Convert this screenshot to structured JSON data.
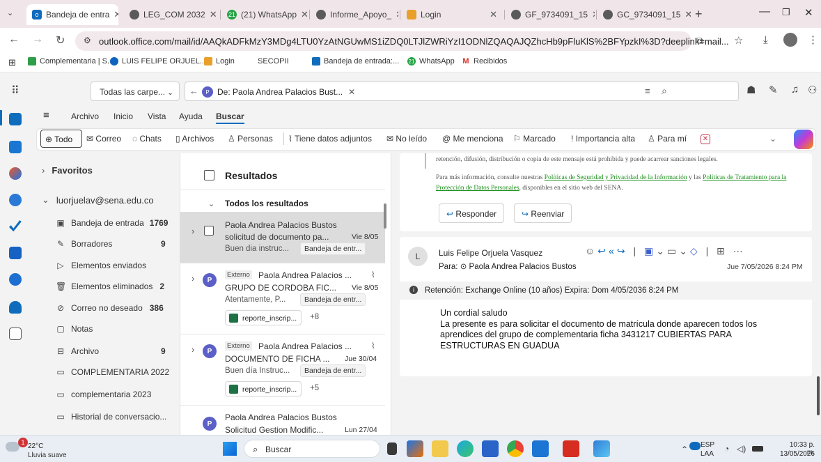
{
  "browser": {
    "tabs": [
      {
        "label": "Bandeja de entra",
        "active": true
      },
      {
        "label": "LEG_COM 2032",
        "active": false
      },
      {
        "label": "(21) WhatsApp",
        "active": false
      },
      {
        "label": "Informe_Apoyo_",
        "active": false
      },
      {
        "label": "Login",
        "active": false
      },
      {
        "label": "GF_9734091_15",
        "active": false
      },
      {
        "label": "GC_9734091_15",
        "active": false
      }
    ],
    "new_tab": "+",
    "url": "outlook.office.com/mail/id/AAQkADFkMzY3MDg4LTU0YzAtNGUwMS1iZDQ0LTJlZWRiYzI1ODNlZQAQAJQZhcHb9pFluKlS%2BFYpzkI%3D?deeplink=mail...",
    "bookmarks": [
      "Complementaria | S...",
      "LUIS FELIPE ORJUEL...",
      "Login",
      "SECOPII",
      "Bandeja de entrada:...",
      "WhatsApp",
      "Recibidos"
    ]
  },
  "outlook": {
    "folder_scope": "Todas las carpe...",
    "search_chip": "De: Paola Andrea Palacios Bust...",
    "chip_initial": "P",
    "menu": [
      "Archivo",
      "Inicio",
      "Vista",
      "Ayuda",
      "Buscar"
    ],
    "filters": [
      "Todo",
      "Correo",
      "Chats",
      "Archivos",
      "Personas",
      "Tiene datos adjuntos",
      "No leído",
      "Me menciona",
      "Marcado",
      "Importancia alta",
      "Para mí"
    ]
  },
  "folders": {
    "favorites": "Favoritos",
    "account": "luorjuelav@sena.edu.co",
    "items": [
      {
        "label": "Bandeja de entrada",
        "count": "1769"
      },
      {
        "label": "Borradores",
        "count": "9"
      },
      {
        "label": "Elementos enviados",
        "count": ""
      },
      {
        "label": "Elementos eliminados",
        "count": "2"
      },
      {
        "label": "Correo no deseado",
        "count": "386"
      },
      {
        "label": "Notas",
        "count": ""
      },
      {
        "label": "Archivo",
        "count": "9"
      },
      {
        "label": "COMPLEMENTARIA 2022",
        "count": ""
      },
      {
        "label": "complementaria 2023",
        "count": ""
      },
      {
        "label": "Historial de conversacio...",
        "count": ""
      }
    ]
  },
  "results": {
    "header": "Resultados",
    "group": "Todos los resultados",
    "items": [
      {
        "sender": "Paola Andrea Palacios Bustos",
        "subject": "solicitud de documento pa...",
        "date": "Vie 8/05",
        "preview": "Buen dia instruc...",
        "folder": "Bandeja de entr...",
        "tag": "",
        "attachment": "",
        "more": ""
      },
      {
        "sender": "Paola Andrea Palacios ...",
        "subject": "GRUPO DE CORDOBA FIC...",
        "date": "Vie 8/05",
        "preview": "Atentamente, P...",
        "folder": "Bandeja de entr...",
        "tag": "Externo",
        "attachment": "reporte_inscrip...",
        "more": "+8"
      },
      {
        "sender": "Paola Andrea Palacios ...",
        "subject": "DOCUMENTO DE FICHA ...",
        "date": "Jue 30/04",
        "preview": "Buen día Instruc...",
        "folder": "Bandeja de entr...",
        "tag": "Externo",
        "attachment": "reporte_inscrip...",
        "more": "+5"
      },
      {
        "sender": "Paola Andrea Palacios Bustos",
        "subject": "Solicitud Gestion Modific...",
        "date": "Lun 27/04",
        "preview": "",
        "folder": "",
        "tag": "",
        "attachment": "",
        "more": ""
      }
    ]
  },
  "reading": {
    "legal_line": "retención, difusión, distribución o copia de este mensaje está prohibida y puede acarrear sanciones legales.",
    "info_pre": "Para más información, consulte nuestras",
    "info_link1": "Políticas de Seguridad y Privacidad de la Información",
    "info_mid": "y las",
    "info_link2": "Políticas de Tratamiento para la Protección de Datos Personales",
    "info_post": ", disponibles en el sitio web del SENA.",
    "reply": "Responder",
    "forward": "Reenviar",
    "msg": {
      "from": "Luis Felipe Orjuela Vasquez",
      "initial": "L",
      "to_prefix": "Para:",
      "to": "Paola Andrea Palacios Bustos",
      "date": "Jue 7/05/2026 8:24 PM",
      "retention": "Retención: Exchange Online (10 años) Expira: Dom 4/05/2036 8:24 PM",
      "body": [
        "Un cordial saludo",
        "La presente es para solicitar el documento de matrícula donde aparecen todos los",
        "aprendices del grupo de complementaria ficha 3431217 CUBIERTAS PARA",
        "ESTRUCTURAS EN GUADUA"
      ]
    }
  },
  "taskbar": {
    "weather_temp": "22°C",
    "weather_desc": "Lluvia suave",
    "weather_badge": "1",
    "search": "Buscar",
    "lang1": "ESP",
    "lang2": "LAA",
    "time": "10:33 p. m.",
    "date": "13/05/2026"
  },
  "colors": {
    "accent": "#0f6cbd",
    "link": "#1a8f1a",
    "avatar": "#5b5fc7"
  }
}
